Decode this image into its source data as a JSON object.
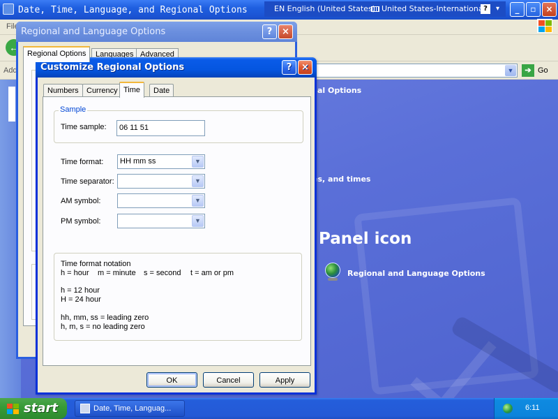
{
  "taskbar_window": {
    "title": "Date, Time, Language, and Regional Options",
    "menu_file_partial": "File",
    "address_label_partial": "Add",
    "go_label": "Go",
    "content": {
      "heading_partial_1": "al Options",
      "heading_partial_2": "es, and times",
      "control_panel_icon_partial": "Panel icon",
      "link_regional": "Regional and Language Options"
    }
  },
  "language_bar": {
    "language": "EN English (United States)",
    "keyboard": "United States-International",
    "help": "?",
    "options_arrow": "▾"
  },
  "window_buttons": {
    "minimize": "_",
    "maximize": "▫",
    "close": "×",
    "help": "?"
  },
  "regional_window": {
    "title": "Regional and Language Options",
    "tabs": [
      "Regional Options",
      "Languages",
      "Advanced"
    ]
  },
  "customize_dialog": {
    "title": "Customize Regional Options",
    "tabs": [
      "Numbers",
      "Currency",
      "Time",
      "Date"
    ],
    "active_tab": "Time",
    "sample": {
      "group_label": "Sample",
      "label": "Time sample:",
      "value": "06 11 51"
    },
    "fields": {
      "time_format": {
        "label": "Time format:",
        "value": "HH mm ss"
      },
      "time_separator": {
        "label": "Time separator:",
        "value": " "
      },
      "am_symbol": {
        "label": "AM symbol:",
        "value": ""
      },
      "pm_symbol": {
        "label": "PM symbol:",
        "value": ""
      }
    },
    "notation": {
      "title": "Time format notation",
      "line1": [
        "h = hour",
        "m = minute",
        "s = second",
        "t = am or pm"
      ],
      "line2": "h = 12 hour",
      "line3": "H = 24 hour",
      "line4": "hh, mm, ss = leading zero",
      "line5": "h, m, s = no leading zero"
    },
    "buttons": {
      "ok": "OK",
      "cancel": "Cancel",
      "apply": "Apply"
    }
  },
  "taskbar": {
    "start_label": "start",
    "task_item": "Date, Time, Languag...",
    "clock": "6:11"
  },
  "colors": {
    "xp_blue": "#0556e0",
    "selection": "#316ac5",
    "group_label": "#0046d5",
    "start_green": "#369a36"
  }
}
